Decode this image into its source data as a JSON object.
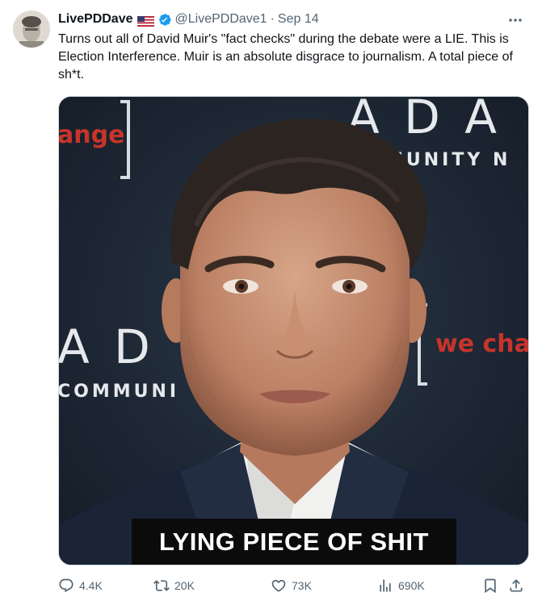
{
  "author": {
    "display_name": "LivePDDave",
    "handle": "@LivePDDave1",
    "separator": "·",
    "date": "Sep 14",
    "flag_icon": "us-flag-icon",
    "verified_icon": "verified-badge-icon",
    "verified_color": "#1d9bf0"
  },
  "tweet": {
    "text": "Turns out all of David Muir's \"fact checks\" during the debate were a LIE. This is Election Interference. Muir is an absolute disgrace to journalism. A total piece of sh*t."
  },
  "media": {
    "caption": "LYING PIECE OF SHIT",
    "backdrop_texts": {
      "top_left": "ange",
      "top_right": "A D A",
      "top_right_sub": "MUNITY N",
      "left": "A D",
      "left_sub": "COMMUNI",
      "right": "we cha"
    }
  },
  "actions": {
    "reply_count": "4.4K",
    "retweet_count": "20K",
    "like_count": "73K",
    "views_count": "690K"
  },
  "colors": {
    "secondary_text": "#536471",
    "primary_text": "#0f1419",
    "backdrop_red": "#c8342b"
  }
}
